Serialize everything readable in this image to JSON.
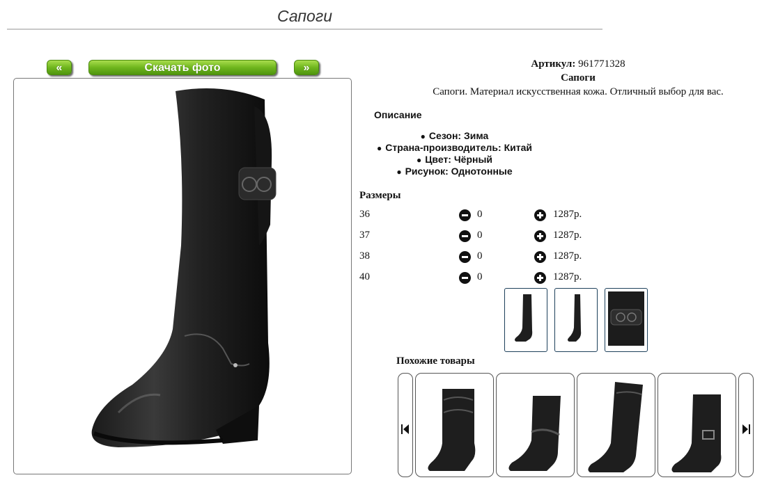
{
  "page": {
    "title": "Сапоги"
  },
  "nav": {
    "prev_label": "«",
    "download_label": "Скачать фото",
    "next_label": "»"
  },
  "product": {
    "article_label": "Артикул:",
    "article_value": "961771328",
    "name": "Сапоги",
    "description": "Сапоги. Материал искусственная кожа. Отличный выбор для вас.",
    "description_heading": "Описание",
    "attributes": [
      "Сезон: Зима",
      "Страна-производитель: Китай",
      "Цвет: Чёрный",
      "Рисунок: Однотонные"
    ]
  },
  "sizes": {
    "heading": "Размеры",
    "rows": [
      {
        "size": "36",
        "qty": "0",
        "price": "1287р."
      },
      {
        "size": "37",
        "qty": "0",
        "price": "1287р."
      },
      {
        "size": "38",
        "qty": "0",
        "price": "1287р."
      },
      {
        "size": "40",
        "qty": "0",
        "price": "1287р."
      }
    ]
  },
  "thumbnails": [
    "boot-side-view",
    "boot-front-view",
    "strap-detail"
  ],
  "similar": {
    "heading": "Похожие товары",
    "items": [
      "black-slouch-boot",
      "black-ankle-boot-with-strap",
      "black-tall-boot",
      "black-boot-with-buckle"
    ]
  },
  "icons": {
    "minus": "minus-circle-icon",
    "plus": "plus-circle-icon",
    "carousel_prev": "skip-back-icon",
    "carousel_next": "skip-forward-icon"
  },
  "colors": {
    "button_green": "#6fb61e",
    "frame_border": "#1c3f5a",
    "rule": "#c8c8c8"
  }
}
